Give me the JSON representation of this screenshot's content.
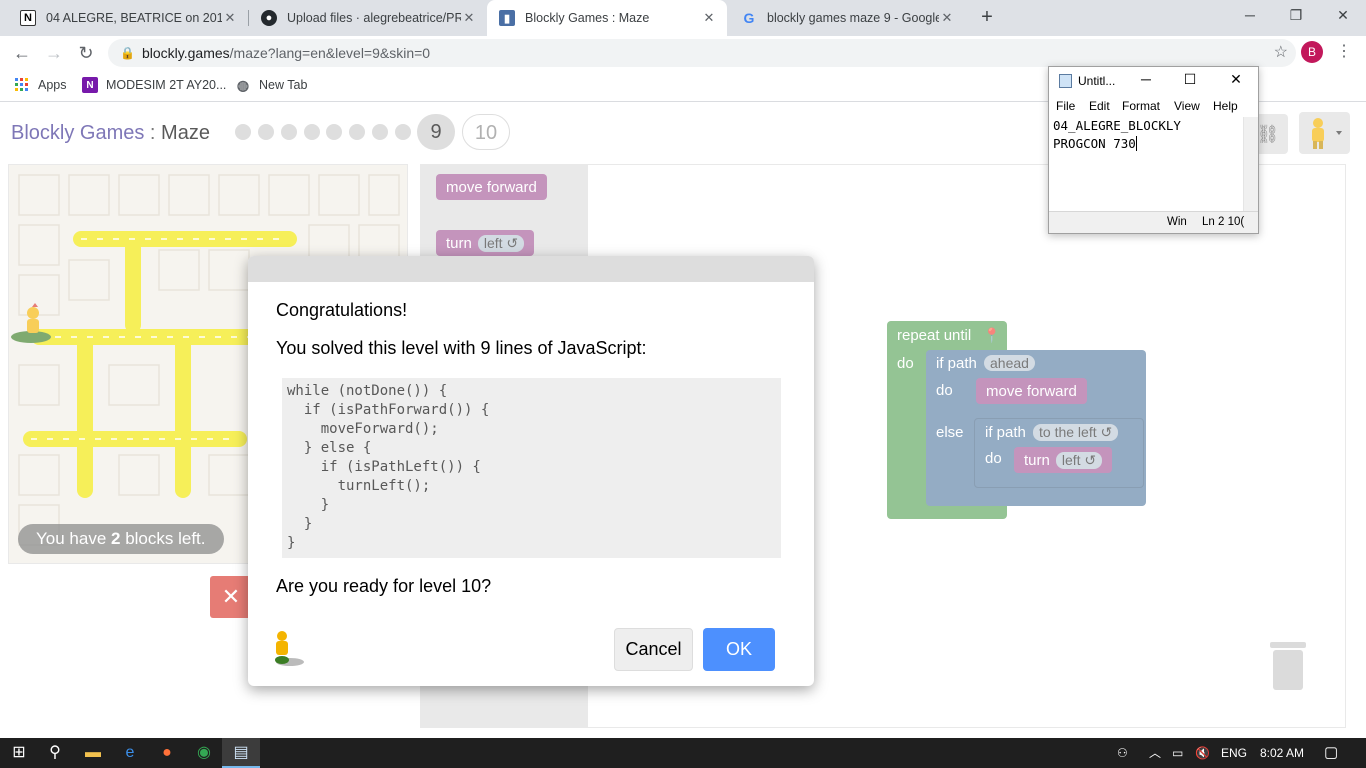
{
  "browser": {
    "tabs": [
      {
        "title": "04 ALEGRE, BEATRICE on 2019T2",
        "icon": "notion-icon",
        "active": false
      },
      {
        "title": "Upload files · alegrebeatrice/PRC",
        "icon": "github-icon",
        "active": false
      },
      {
        "title": "Blockly Games : Maze",
        "icon": "blockly-icon",
        "active": true
      },
      {
        "title": "blockly games maze 9 - Google S",
        "icon": "google-icon",
        "active": false
      }
    ],
    "new_tab": "+",
    "url_host": "blockly.games",
    "url_path": "/maze?lang=en&level=9&skin=0",
    "profile_initial": "B",
    "bookmarks": [
      {
        "label": "Apps",
        "icon": "apps-grid-icon"
      },
      {
        "label": "MODESIM 2T AY20...",
        "icon": "onenote-icon"
      },
      {
        "label": "New Tab",
        "icon": "globe-icon"
      }
    ]
  },
  "game": {
    "title_app": "Blockly Games",
    "title_sep": " : ",
    "title_game": "Maze",
    "current_level": "9",
    "next_level": "10",
    "blocks_left_prefix": "You have ",
    "blocks_left_count": "2",
    "blocks_left_suffix": " blocks left.",
    "toolbox": {
      "move_forward": "move forward",
      "turn": "turn",
      "turn_dir": "left ↺"
    },
    "workspace": {
      "repeat_until": "repeat until",
      "do": "do",
      "if_path": "if path",
      "ahead": "ahead",
      "move_forward": "move forward",
      "else": "else",
      "to_the_left": "to the left ↺",
      "turn": "turn",
      "left": "left ↺"
    }
  },
  "dialog": {
    "congrats": "Congratulations!",
    "solved": "You solved this level with 9 lines of JavaScript:",
    "code_lines": [
      "while (notDone()) {",
      "  if (isPathForward()) {",
      "    moveForward();",
      "  } else {",
      "    if (isPathLeft()) {",
      "      turnLeft();",
      "    }",
      "  }",
      "}"
    ],
    "ready": "Are you ready for level 10?",
    "cancel": "Cancel",
    "ok": "OK"
  },
  "notepad": {
    "title": "Untitl...",
    "menu": [
      "File",
      "Edit",
      "Format",
      "View",
      "Help"
    ],
    "text_line1": "04_ALEGRE_BLOCKLY",
    "text_line2": "PROGCON 730",
    "status_enc": "Win",
    "status_pos": "Ln 2 10("
  },
  "taskbar": {
    "lang": "ENG",
    "time": "8:02 AM"
  },
  "colors": {
    "accent_blue": "#4d90fe",
    "blockly_green": "#5ba55b",
    "blockly_blue": "#5b80a5",
    "blockly_purple": "#a55b99",
    "maze_path": "#f2e600",
    "title_purple": "#3a2e91"
  }
}
